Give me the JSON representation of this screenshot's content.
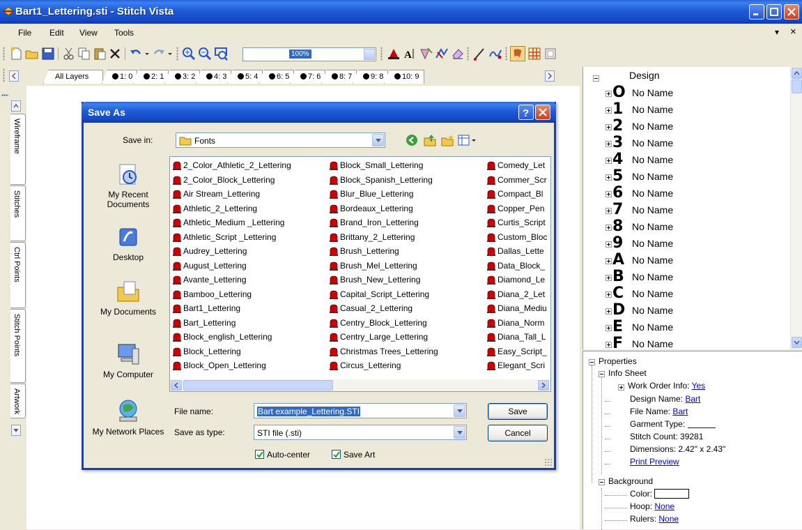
{
  "window": {
    "title": "Bart1_Lettering.sti - Stitch Vista"
  },
  "menu": {
    "items": [
      "File",
      "Edit",
      "View",
      "Tools"
    ],
    "right_glyphs": [
      "▾",
      "×"
    ]
  },
  "toolbar": {
    "zoom_value": "100%"
  },
  "layers": {
    "all_label": "All Layers",
    "tabs": [
      "1: 0",
      "2: 1",
      "3: 2",
      "4: 3",
      "5: 4",
      "6: 5",
      "7: 6",
      "8: 7",
      "9: 8",
      "10: 9"
    ]
  },
  "side_tabs": [
    "Wireframe",
    "Stitches",
    "Ctrl Points",
    "Stitch Points",
    "Artwork"
  ],
  "design_panel": {
    "root_label": "Design",
    "nodes": [
      {
        "glyph": "O",
        "label": "No Name"
      },
      {
        "glyph": "1",
        "label": "No Name"
      },
      {
        "glyph": "2",
        "label": "No Name"
      },
      {
        "glyph": "3",
        "label": "No Name"
      },
      {
        "glyph": "4",
        "label": "No Name"
      },
      {
        "glyph": "5",
        "label": "No Name"
      },
      {
        "glyph": "6",
        "label": "No Name"
      },
      {
        "glyph": "7",
        "label": "No Name"
      },
      {
        "glyph": "8",
        "label": "No Name"
      },
      {
        "glyph": "9",
        "label": "No Name"
      },
      {
        "glyph": "A",
        "label": "No Name"
      },
      {
        "glyph": "B",
        "label": "No Name"
      },
      {
        "glyph": "C",
        "label": "No Name"
      },
      {
        "glyph": "D",
        "label": "No Name"
      },
      {
        "glyph": "E",
        "label": "No Name"
      },
      {
        "glyph": "F",
        "label": "No Name"
      }
    ]
  },
  "properties": {
    "root_label": "Properties",
    "info_sheet_label": "Info Sheet",
    "work_order_label": "Work Order Info:",
    "work_order_value": "Yes",
    "design_name_label": "Design Name:",
    "design_name_value": "Bart",
    "file_name_label": "File Name:",
    "file_name_value": "Bart",
    "garment_type_label": "Garment Type:",
    "garment_type_value": "",
    "stitch_count_text": "Stitch Count: 39281",
    "dimensions_text": "Dimensions: 2.42\" x 2.43\"",
    "print_preview": "Print Preview",
    "background_label": "Background",
    "color_label": "Color:",
    "hoop_label": "Hoop:",
    "hoop_value": "None",
    "rulers_label": "Rulers:",
    "rulers_value": "None"
  },
  "dialog": {
    "title": "Save As",
    "save_in_label": "Save in:",
    "save_in_value": "Fonts",
    "places": [
      "My Recent Documents",
      "Desktop",
      "My Documents",
      "My Computer",
      "My Network Places"
    ],
    "files_col1": [
      "2_Color_Athletic_2_Lettering",
      "2_Color_Block_Lettering",
      "Air Stream_Lettering",
      "Athletic_2_Lettering",
      "Athletic_Medium _Lettering",
      "Athletic_Script _Lettering",
      "Audrey_Lettering",
      "August_Lettering",
      "Avante_Lettering",
      "Bamboo_Lettering",
      "Bart1_Lettering",
      "Bart_Lettering",
      "Block_english_Lettering",
      "Block_Lettering",
      "Block_Open_Lettering"
    ],
    "files_col2": [
      "Block_Small_Lettering",
      "Block_Spanish_Lettering",
      "Blur_Blue_Lettering",
      "Bordeaux_Lettering",
      "Brand_Iron_Lettering",
      "Brittany_2_Lettering",
      "Brush_Lettering",
      "Brush_Mel_Lettering",
      "Brush_New_Lettering",
      "Capital_Script_Lettering",
      "Casual_2_Lettering",
      "Centry_Block_Lettering",
      "Centry_Large_Lettering",
      "Christmas Trees_Lettering",
      "Circus_Lettering"
    ],
    "files_col3": [
      "Comedy_Let",
      "Commer_Scr",
      "Compact_Bl",
      "Copper_Pen",
      "Curtis_Script",
      "Custom_Bloc",
      "Dallas_Lette",
      "Data_Block_",
      "Diamond_Le",
      "Diana_2_Let",
      "Diana_Mediu",
      "Diana_Norm",
      "Diana_Tall_L",
      "Easy_Script_",
      "Elegant_Scri"
    ],
    "file_name_label": "File name:",
    "file_name_value": "Bart example_Lettering.STI",
    "save_type_label": "Save as type:",
    "save_type_value": "STI file (.sti)",
    "save_button": "Save",
    "cancel_button": "Cancel",
    "auto_center_label": "Auto-center",
    "save_art_label": "Save Art"
  },
  "colors": {
    "xp_blue": "#1f5bd6",
    "close_red": "#c8421f",
    "file_icon_red": "#cc0000",
    "link": "#0000ee"
  }
}
